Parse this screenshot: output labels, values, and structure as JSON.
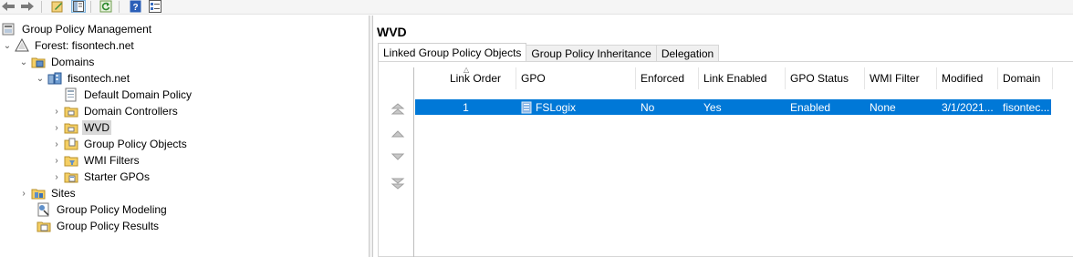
{
  "toolbar": {
    "buttons": [
      "back-icon",
      "forward-icon",
      "edit-icon",
      "show-hide-tree-icon",
      "refresh-icon",
      "help-icon",
      "properties-icon"
    ]
  },
  "tree": {
    "root": "Group Policy Management",
    "forest": "Forest: fisontech.net",
    "domains": "Domains",
    "domain": "fisontech.net",
    "default_policy": "Default Domain Policy",
    "domain_controllers": "Domain Controllers",
    "wvd": "WVD",
    "gpo_objects": "Group Policy Objects",
    "wmi_filters": "WMI Filters",
    "starter_gpos": "Starter GPOs",
    "sites": "Sites",
    "modeling": "Group Policy Modeling",
    "results": "Group Policy Results"
  },
  "right": {
    "title": "WVD",
    "tabs": [
      "Linked Group Policy Objects",
      "Group Policy Inheritance",
      "Delegation"
    ],
    "columns": [
      "Link Order",
      "GPO",
      "Enforced",
      "Link Enabled",
      "GPO Status",
      "WMI Filter",
      "Modified",
      "Domain"
    ],
    "rows": [
      {
        "link_order": "1",
        "gpo": "FSLogix",
        "enforced": "No",
        "link_enabled": "Yes",
        "gpo_status": "Enabled",
        "wmi_filter": "None",
        "modified": "3/1/2021...",
        "domain": "fisontec..."
      }
    ]
  },
  "colors": {
    "selection": "#0078d7",
    "tree_selected": "#d9d9d9"
  }
}
